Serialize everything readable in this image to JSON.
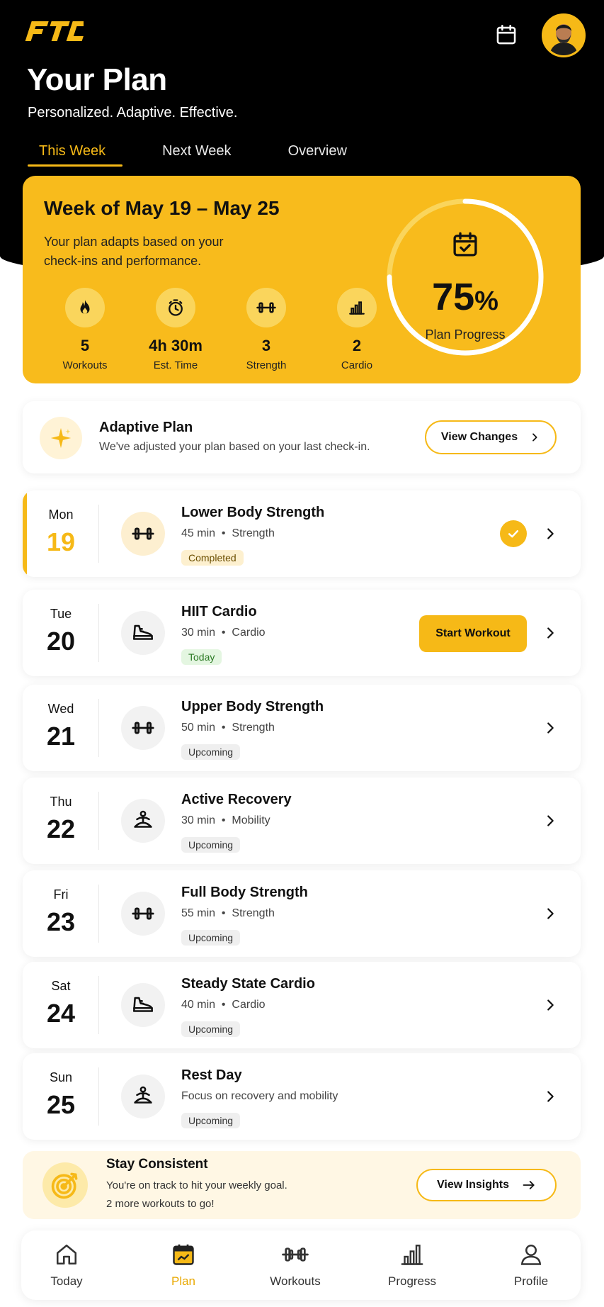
{
  "header": {
    "logo_text": "FTC",
    "title": "Your Plan",
    "subtitle": "Personalized. Adaptive. Effective.",
    "tabs": [
      {
        "label": "This Week",
        "active": true
      },
      {
        "label": "Next Week",
        "active": false
      },
      {
        "label": "Overview",
        "active": false
      }
    ]
  },
  "week": {
    "title": "Week of May 19 – May 25",
    "description": "Your plan adapts based on your check-ins and performance.",
    "stats": [
      {
        "value": "5",
        "label": "Workouts",
        "icon": "flame-icon"
      },
      {
        "value": "4h 30m",
        "label": "Est. Time",
        "icon": "stopwatch-icon"
      },
      {
        "value": "3",
        "label": "Strength",
        "icon": "dumbbell-icon"
      },
      {
        "value": "2",
        "label": "Cardio",
        "icon": "bar-chart-icon"
      }
    ],
    "progress_value": "75",
    "progress_unit": "%",
    "progress_fraction": 0.75,
    "progress_label": "Plan Progress"
  },
  "adaptive": {
    "title": "Adaptive Plan",
    "description": "We've adjusted your plan based on your last check-in.",
    "button_label": "View Changes"
  },
  "days": [
    {
      "day": "Mon",
      "date": "19",
      "title": "Lower Body Strength",
      "duration": "45 min",
      "type": "Strength",
      "status": "Completed",
      "icon": "dumbbell-icon"
    },
    {
      "day": "Tue",
      "date": "20",
      "title": "HIIT Cardio",
      "duration": "30 min",
      "type": "Cardio",
      "status": "Today",
      "icon": "shoe-icon",
      "action_label": "Start Workout"
    },
    {
      "day": "Wed",
      "date": "21",
      "title": "Upper Body Strength",
      "duration": "50 min",
      "type": "Strength",
      "status": "Upcoming",
      "icon": "dumbbell-icon"
    },
    {
      "day": "Thu",
      "date": "22",
      "title": "Active Recovery",
      "duration": "30 min",
      "type": "Mobility",
      "status": "Upcoming",
      "icon": "meditation-icon"
    },
    {
      "day": "Fri",
      "date": "23",
      "title": "Full Body Strength",
      "duration": "55 min",
      "type": "Strength",
      "status": "Upcoming",
      "icon": "dumbbell-icon"
    },
    {
      "day": "Sat",
      "date": "24",
      "title": "Steady State Cardio",
      "duration": "40 min",
      "type": "Cardio",
      "status": "Upcoming",
      "icon": "shoe-icon"
    },
    {
      "day": "Sun",
      "date": "25",
      "title": "Rest Day",
      "description": "Focus on recovery and mobility",
      "status": "Upcoming",
      "icon": "meditation-icon"
    }
  ],
  "consistent": {
    "title": "Stay Consistent",
    "line1": "You're on track to hit your weekly goal.",
    "line2": "2 more workouts to go!",
    "button_label": "View Insights"
  },
  "nav": [
    {
      "label": "Today",
      "icon": "home-icon",
      "active": false
    },
    {
      "label": "Plan",
      "icon": "calendar-icon",
      "active": true
    },
    {
      "label": "Workouts",
      "icon": "dumbbell-icon",
      "active": false
    },
    {
      "label": "Progress",
      "icon": "bar-chart-icon",
      "active": false
    },
    {
      "label": "Profile",
      "icon": "person-icon",
      "active": false
    }
  ],
  "colors": {
    "accent": "#f6b917",
    "background": "#ffffff",
    "hero": "#000000"
  }
}
